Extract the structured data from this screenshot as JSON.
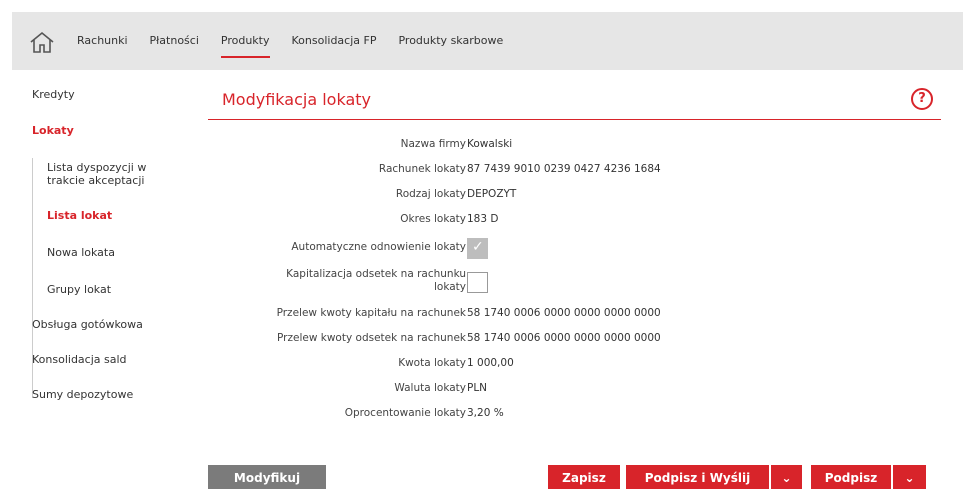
{
  "topnav": {
    "items": [
      "Rachunki",
      "Płatności",
      "Produkty",
      "Konsolidacja FP",
      "Produkty skarbowe"
    ]
  },
  "sidebar": {
    "kredyty": "Kredyty",
    "lokaty": "Lokaty",
    "sub": [
      "Lista dyspozycji w trakcie akceptacji",
      "Lista lokat",
      "Nowa lokata",
      "Grupy lokat"
    ],
    "obsluga": "Obsługa gotówkowa",
    "konsolidacja": "Konsolidacja sald",
    "sumy": "Sumy depozytowe"
  },
  "main": {
    "title": "Modyfikacja lokaty",
    "help": "?",
    "fields": {
      "nazwa_label": "Nazwa firmy",
      "nazwa_value": "Kowalski",
      "rachunek_label": "Rachunek lokaty",
      "rachunek_value": "87 7439 9010 0239 0427 4236 1684",
      "rodzaj_label": "Rodzaj lokaty",
      "rodzaj_value": "DEPOZYT",
      "okres_label": "Okres lokaty",
      "okres_value": "183 D",
      "auto_label": "Automatyczne odnowienie lokaty",
      "auto_checked": true,
      "kap_label": "Kapitalizacja odsetek na rachunku lokaty",
      "kap_checked": false,
      "kapital_label": "Przelew kwoty kapitału na rachunek",
      "kapital_value": "58 1740 0006 0000 0000 0000 0000",
      "odsetki_label": "Przelew kwoty odsetek na rachunek",
      "odsetki_value": "58 1740 0006 0000 0000 0000 0000",
      "kwota_label": "Kwota lokaty",
      "kwota_value": "1 000,00",
      "waluta_label": "Waluta lokaty",
      "waluta_value": "PLN",
      "oproc_label": "Oprocentowanie lokaty",
      "oproc_value": "3,20 %"
    }
  },
  "buttons": {
    "modyfikuj": "Modyfikuj",
    "zapisz": "Zapisz",
    "podpisz_wyslij": "Podpisz i Wyślij",
    "podpisz": "Podpisz",
    "arrow": "⌄"
  },
  "colors": {
    "accent": "#d8242a",
    "topbar": "#e6e6e6",
    "gray_button": "#7b7b7b"
  }
}
